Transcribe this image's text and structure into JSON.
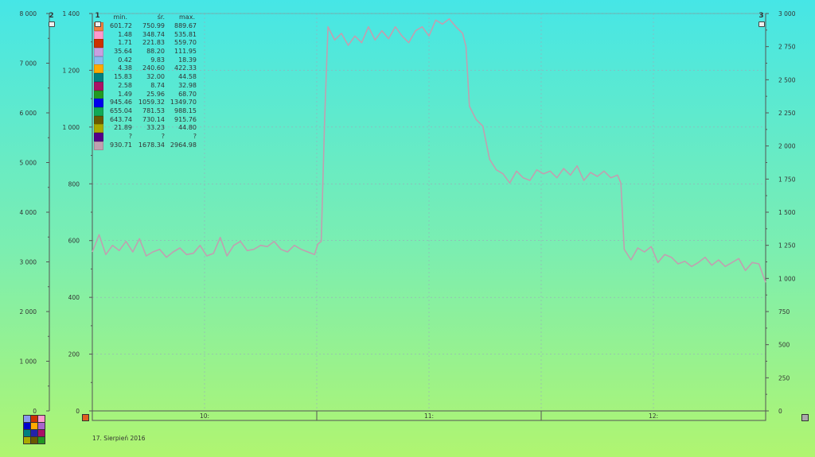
{
  "chart_data": {
    "type": "line",
    "date": "17. Sierpień 2016",
    "x_labels": [
      "10:",
      "11:",
      "12:"
    ],
    "axes": {
      "left_outer": {
        "id": "2",
        "ticks": [
          "0",
          "1 000",
          "2 000",
          "3 000",
          "4 000",
          "5 000",
          "6 000",
          "7 000",
          "8 000"
        ],
        "ylim": [
          0,
          8000
        ]
      },
      "left_inner": {
        "id": "1",
        "ticks": [
          "0",
          "200",
          "400",
          "600",
          "800",
          "1 000",
          "1 200",
          "1 400"
        ],
        "ylim": [
          0,
          1400
        ]
      },
      "right": {
        "id": "3",
        "ticks": [
          "0",
          "250",
          "500",
          "750",
          "1 000",
          "1 250",
          "1 500",
          "1 750",
          "2 000",
          "2 250",
          "2 500",
          "2 750",
          "3 000"
        ],
        "ylim": [
          0,
          3000
        ]
      }
    },
    "stats_header": {
      "min": "min.",
      "avg": "śr.",
      "max": "max."
    },
    "legend": [
      {
        "color": "#f08040",
        "min": "601.72",
        "avg": "750.99",
        "max": "889.67"
      },
      {
        "color": "#ff99cc",
        "min": "1.48",
        "avg": "348.74",
        "max": "535.81"
      },
      {
        "color": "#cc3300",
        "min": "1.71",
        "avg": "221.83",
        "max": "559.70"
      },
      {
        "color": "#c8a0e0",
        "min": "35.64",
        "avg": "88.20",
        "max": "111.95"
      },
      {
        "color": "#88bbee",
        "min": "0.42",
        "avg": "9.83",
        "max": "18.39"
      },
      {
        "color": "#ffaa00",
        "min": "4.38",
        "avg": "240.60",
        "max": "422.33"
      },
      {
        "color": "#008080",
        "min": "15.83",
        "avg": "32.00",
        "max": "44.58"
      },
      {
        "color": "#aa1166",
        "min": "2.58",
        "avg": "8.74",
        "max": "32.98"
      },
      {
        "color": "#229922",
        "min": "1.49",
        "avg": "25.96",
        "max": "68.70"
      },
      {
        "color": "#0000ee",
        "min": "945.46",
        "avg": "1059.32",
        "max": "1349.70"
      },
      {
        "color": "#11aa55",
        "min": "655.04",
        "avg": "781.53",
        "max": "988.15"
      },
      {
        "color": "#6a5a00",
        "min": "643.74",
        "avg": "730.14",
        "max": "915.76"
      },
      {
        "color": "#aaaa00",
        "min": "21.89",
        "avg": "33.23",
        "max": "44.80"
      },
      {
        "color": "#550088",
        "min": "?",
        "avg": "?",
        "max": "?"
      },
      {
        "color": "#c0a0b0",
        "min": "930.71",
        "avg": "1678.34",
        "max": "2964.98"
      }
    ],
    "series": [
      {
        "color": "#c0a0b0",
        "axis": "right",
        "x": [
          0,
          0.01,
          0.02,
          0.03,
          0.04,
          0.05,
          0.06,
          0.07,
          0.08,
          0.09,
          0.1,
          0.11,
          0.12,
          0.13,
          0.14,
          0.15,
          0.16,
          0.17,
          0.18,
          0.19,
          0.2,
          0.21,
          0.22,
          0.23,
          0.24,
          0.25,
          0.26,
          0.27,
          0.28,
          0.29,
          0.3,
          0.31,
          0.32,
          0.33,
          0.335,
          0.34,
          0.345,
          0.35,
          0.36,
          0.37,
          0.38,
          0.39,
          0.4,
          0.41,
          0.42,
          0.43,
          0.44,
          0.45,
          0.46,
          0.47,
          0.48,
          0.49,
          0.5,
          0.51,
          0.52,
          0.53,
          0.54,
          0.55,
          0.555,
          0.56,
          0.57,
          0.58,
          0.59,
          0.6,
          0.61,
          0.62,
          0.63,
          0.64,
          0.65,
          0.66,
          0.67,
          0.68,
          0.69,
          0.7,
          0.71,
          0.72,
          0.73,
          0.74,
          0.75,
          0.76,
          0.77,
          0.78,
          0.785,
          0.79,
          0.8,
          0.81,
          0.82,
          0.83,
          0.84,
          0.85,
          0.86,
          0.87,
          0.88,
          0.89,
          0.9,
          0.91,
          0.92,
          0.93,
          0.94,
          0.95,
          0.96,
          0.97,
          0.98,
          0.99,
          1.0
        ],
        "values": [
          1200,
          1330,
          1180,
          1250,
          1210,
          1280,
          1200,
          1300,
          1170,
          1200,
          1220,
          1160,
          1200,
          1230,
          1180,
          1190,
          1250,
          1170,
          1190,
          1310,
          1170,
          1250,
          1280,
          1210,
          1220,
          1250,
          1240,
          1280,
          1220,
          1200,
          1250,
          1220,
          1200,
          1180,
          1260,
          1280,
          2200,
          2900,
          2800,
          2850,
          2760,
          2830,
          2780,
          2900,
          2800,
          2870,
          2810,
          2900,
          2830,
          2780,
          2870,
          2900,
          2830,
          2950,
          2920,
          2960,
          2900,
          2850,
          2750,
          2300,
          2200,
          2150,
          1900,
          1820,
          1790,
          1720,
          1810,
          1760,
          1740,
          1820,
          1790,
          1810,
          1760,
          1830,
          1780,
          1850,
          1740,
          1800,
          1770,
          1810,
          1760,
          1780,
          1720,
          1220,
          1140,
          1230,
          1200,
          1240,
          1120,
          1180,
          1160,
          1110,
          1130,
          1090,
          1120,
          1160,
          1100,
          1140,
          1090,
          1120,
          1150,
          1060,
          1120,
          1110,
          970
        ]
      }
    ]
  }
}
